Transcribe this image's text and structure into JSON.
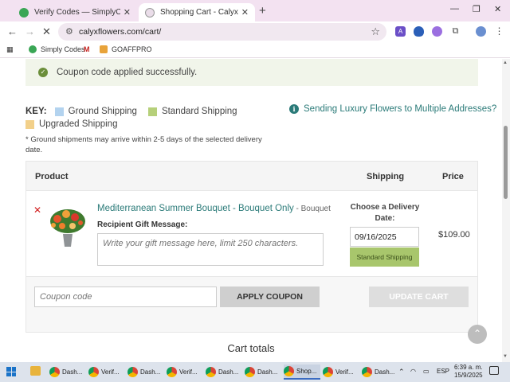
{
  "browser": {
    "tabs": [
      {
        "title": "Verify Codes — SimplyCodes",
        "active": false
      },
      {
        "title": "Shopping Cart - Calyx Flowers",
        "active": true
      }
    ],
    "url": "calyxflowers.com/cart/",
    "bookmarks": [
      "Simply Codes",
      "GOAFFPRO"
    ]
  },
  "page": {
    "notice": "Coupon code applied successfully.",
    "key": {
      "label": "KEY:",
      "items": [
        {
          "label": "Ground Shipping",
          "color": "#b3d3ef"
        },
        {
          "label": "Standard Shipping",
          "color": "#b6d07a"
        },
        {
          "label": "Upgraded Shipping",
          "color": "#f2d08a"
        }
      ],
      "note": "* Ground shipments may arrive within 2-5 days of the selected delivery date."
    },
    "multi_address_link": "Sending Luxury Flowers to Multiple Addresses?",
    "cart": {
      "headers": {
        "product": "Product",
        "shipping": "Shipping",
        "price": "Price"
      },
      "item": {
        "name": "Mediterranean Summer Bouquet - Bouquet Only",
        "category": " - Bouquet",
        "gift_label": "Recipient Gift Message:",
        "gift_placeholder": "Write your gift message here, limit 250 characters.",
        "delivery_label": "Choose a Delivery Date:",
        "delivery_date": "09/16/2025",
        "shipping_method": "Standard Shipping",
        "price": "$109.00"
      },
      "coupon_placeholder": "Coupon code",
      "apply_label": "APPLY COUPON",
      "update_label": "UPDATE CART"
    },
    "totals_title": "Cart totals"
  },
  "taskbar": {
    "items": [
      "Dash...",
      "Verif...",
      "Dash...",
      "Verif...",
      "Dash...",
      "Dash...",
      "Shop...",
      "Verif...",
      "Dash..."
    ],
    "active_index": 6,
    "lang": "ESP",
    "time": "6:39 a. m.",
    "date": "15/9/2025"
  }
}
